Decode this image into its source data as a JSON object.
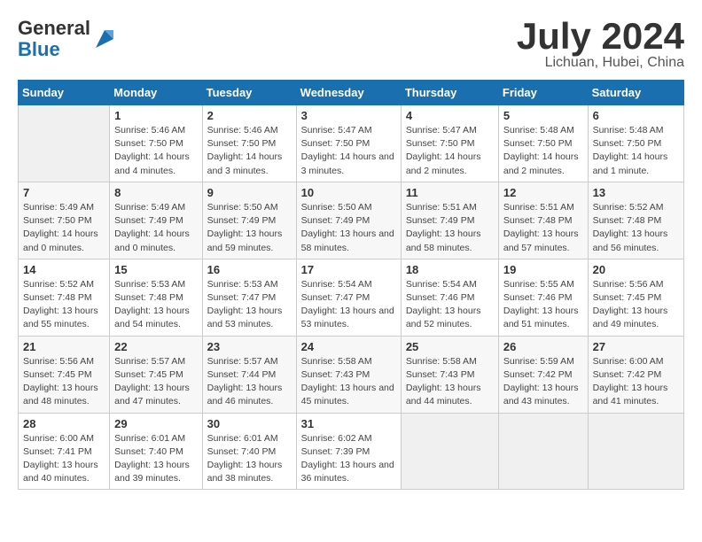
{
  "header": {
    "logo_general": "General",
    "logo_blue": "Blue",
    "month_title": "July 2024",
    "location": "Lichuan, Hubei, China"
  },
  "calendar": {
    "days_of_week": [
      "Sunday",
      "Monday",
      "Tuesday",
      "Wednesday",
      "Thursday",
      "Friday",
      "Saturday"
    ],
    "weeks": [
      [
        {
          "day": "",
          "empty": true
        },
        {
          "day": "1",
          "sunrise": "Sunrise: 5:46 AM",
          "sunset": "Sunset: 7:50 PM",
          "daylight": "Daylight: 14 hours and 4 minutes."
        },
        {
          "day": "2",
          "sunrise": "Sunrise: 5:46 AM",
          "sunset": "Sunset: 7:50 PM",
          "daylight": "Daylight: 14 hours and 3 minutes."
        },
        {
          "day": "3",
          "sunrise": "Sunrise: 5:47 AM",
          "sunset": "Sunset: 7:50 PM",
          "daylight": "Daylight: 14 hours and 3 minutes."
        },
        {
          "day": "4",
          "sunrise": "Sunrise: 5:47 AM",
          "sunset": "Sunset: 7:50 PM",
          "daylight": "Daylight: 14 hours and 2 minutes."
        },
        {
          "day": "5",
          "sunrise": "Sunrise: 5:48 AM",
          "sunset": "Sunset: 7:50 PM",
          "daylight": "Daylight: 14 hours and 2 minutes."
        },
        {
          "day": "6",
          "sunrise": "Sunrise: 5:48 AM",
          "sunset": "Sunset: 7:50 PM",
          "daylight": "Daylight: 14 hours and 1 minute."
        }
      ],
      [
        {
          "day": "7",
          "sunrise": "Sunrise: 5:49 AM",
          "sunset": "Sunset: 7:50 PM",
          "daylight": "Daylight: 14 hours and 0 minutes."
        },
        {
          "day": "8",
          "sunrise": "Sunrise: 5:49 AM",
          "sunset": "Sunset: 7:49 PM",
          "daylight": "Daylight: 14 hours and 0 minutes."
        },
        {
          "day": "9",
          "sunrise": "Sunrise: 5:50 AM",
          "sunset": "Sunset: 7:49 PM",
          "daylight": "Daylight: 13 hours and 59 minutes."
        },
        {
          "day": "10",
          "sunrise": "Sunrise: 5:50 AM",
          "sunset": "Sunset: 7:49 PM",
          "daylight": "Daylight: 13 hours and 58 minutes."
        },
        {
          "day": "11",
          "sunrise": "Sunrise: 5:51 AM",
          "sunset": "Sunset: 7:49 PM",
          "daylight": "Daylight: 13 hours and 58 minutes."
        },
        {
          "day": "12",
          "sunrise": "Sunrise: 5:51 AM",
          "sunset": "Sunset: 7:48 PM",
          "daylight": "Daylight: 13 hours and 57 minutes."
        },
        {
          "day": "13",
          "sunrise": "Sunrise: 5:52 AM",
          "sunset": "Sunset: 7:48 PM",
          "daylight": "Daylight: 13 hours and 56 minutes."
        }
      ],
      [
        {
          "day": "14",
          "sunrise": "Sunrise: 5:52 AM",
          "sunset": "Sunset: 7:48 PM",
          "daylight": "Daylight: 13 hours and 55 minutes."
        },
        {
          "day": "15",
          "sunrise": "Sunrise: 5:53 AM",
          "sunset": "Sunset: 7:48 PM",
          "daylight": "Daylight: 13 hours and 54 minutes."
        },
        {
          "day": "16",
          "sunrise": "Sunrise: 5:53 AM",
          "sunset": "Sunset: 7:47 PM",
          "daylight": "Daylight: 13 hours and 53 minutes."
        },
        {
          "day": "17",
          "sunrise": "Sunrise: 5:54 AM",
          "sunset": "Sunset: 7:47 PM",
          "daylight": "Daylight: 13 hours and 53 minutes."
        },
        {
          "day": "18",
          "sunrise": "Sunrise: 5:54 AM",
          "sunset": "Sunset: 7:46 PM",
          "daylight": "Daylight: 13 hours and 52 minutes."
        },
        {
          "day": "19",
          "sunrise": "Sunrise: 5:55 AM",
          "sunset": "Sunset: 7:46 PM",
          "daylight": "Daylight: 13 hours and 51 minutes."
        },
        {
          "day": "20",
          "sunrise": "Sunrise: 5:56 AM",
          "sunset": "Sunset: 7:45 PM",
          "daylight": "Daylight: 13 hours and 49 minutes."
        }
      ],
      [
        {
          "day": "21",
          "sunrise": "Sunrise: 5:56 AM",
          "sunset": "Sunset: 7:45 PM",
          "daylight": "Daylight: 13 hours and 48 minutes."
        },
        {
          "day": "22",
          "sunrise": "Sunrise: 5:57 AM",
          "sunset": "Sunset: 7:45 PM",
          "daylight": "Daylight: 13 hours and 47 minutes."
        },
        {
          "day": "23",
          "sunrise": "Sunrise: 5:57 AM",
          "sunset": "Sunset: 7:44 PM",
          "daylight": "Daylight: 13 hours and 46 minutes."
        },
        {
          "day": "24",
          "sunrise": "Sunrise: 5:58 AM",
          "sunset": "Sunset: 7:43 PM",
          "daylight": "Daylight: 13 hours and 45 minutes."
        },
        {
          "day": "25",
          "sunrise": "Sunrise: 5:58 AM",
          "sunset": "Sunset: 7:43 PM",
          "daylight": "Daylight: 13 hours and 44 minutes."
        },
        {
          "day": "26",
          "sunrise": "Sunrise: 5:59 AM",
          "sunset": "Sunset: 7:42 PM",
          "daylight": "Daylight: 13 hours and 43 minutes."
        },
        {
          "day": "27",
          "sunrise": "Sunrise: 6:00 AM",
          "sunset": "Sunset: 7:42 PM",
          "daylight": "Daylight: 13 hours and 41 minutes."
        }
      ],
      [
        {
          "day": "28",
          "sunrise": "Sunrise: 6:00 AM",
          "sunset": "Sunset: 7:41 PM",
          "daylight": "Daylight: 13 hours and 40 minutes."
        },
        {
          "day": "29",
          "sunrise": "Sunrise: 6:01 AM",
          "sunset": "Sunset: 7:40 PM",
          "daylight": "Daylight: 13 hours and 39 minutes."
        },
        {
          "day": "30",
          "sunrise": "Sunrise: 6:01 AM",
          "sunset": "Sunset: 7:40 PM",
          "daylight": "Daylight: 13 hours and 38 minutes."
        },
        {
          "day": "31",
          "sunrise": "Sunrise: 6:02 AM",
          "sunset": "Sunset: 7:39 PM",
          "daylight": "Daylight: 13 hours and 36 minutes."
        },
        {
          "day": "",
          "empty": true
        },
        {
          "day": "",
          "empty": true
        },
        {
          "day": "",
          "empty": true
        }
      ]
    ]
  }
}
